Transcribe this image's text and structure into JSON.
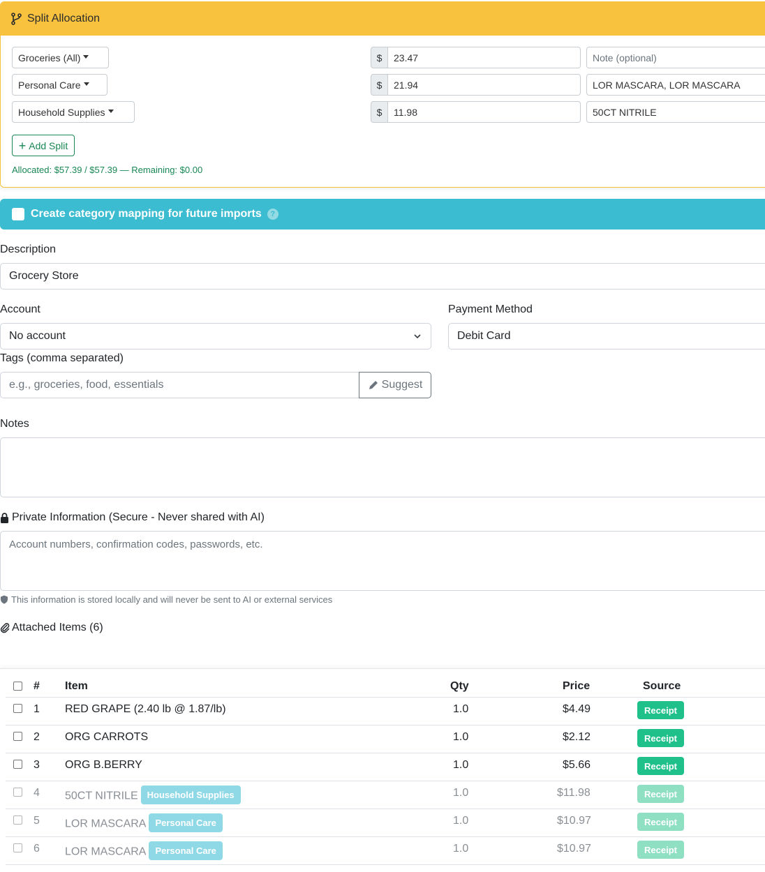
{
  "split": {
    "title": "Split Allocation",
    "rows": [
      {
        "category": "Groceries (All)",
        "currency": "$",
        "amount": "23.47",
        "note": "Note (optional)",
        "note_is_placeholder": true
      },
      {
        "category": "Personal Care",
        "currency": "$",
        "amount": "21.94",
        "note": "LOR MASCARA, LOR MASCARA",
        "note_is_placeholder": false
      },
      {
        "category": "Household Supplies",
        "currency": "$",
        "amount": "11.98",
        "note": "50CT NITRILE",
        "note_is_placeholder": false
      }
    ],
    "add_split_label": "Add Split",
    "allocated_text": "Allocated: $57.39 / $57.39 — Remaining: $0.00"
  },
  "mapping": {
    "label": "Create category mapping for future imports",
    "help": "?"
  },
  "form": {
    "description_label": "Description",
    "description_value": "Grocery Store",
    "account_label": "Account",
    "account_value": "No account",
    "payment_label": "Payment Method",
    "payment_value": "Debit Card",
    "tags_label": "Tags (comma separated)",
    "tags_placeholder": "e.g., groceries, food, essentials",
    "suggest_label": "Suggest",
    "notes_label": "Notes",
    "private_label": "Private Information (Secure - Never shared with AI)",
    "private_placeholder": "Account numbers, confirmation codes, passwords, etc.",
    "private_note": "This information is stored locally and will never be sent to AI or external services",
    "attached_label": "Attached Items (6)"
  },
  "table": {
    "headers": {
      "num": "#",
      "item": "Item",
      "qty": "Qty",
      "price": "Price",
      "source": "Source"
    },
    "rows": [
      {
        "num": "1",
        "item": "RED GRAPE (2.40 lb @ 1.87/lb)",
        "category": "",
        "qty": "1.0",
        "price": "$4.49",
        "source": "Receipt",
        "dim": false
      },
      {
        "num": "2",
        "item": "ORG CARROTS",
        "category": "",
        "qty": "1.0",
        "price": "$2.12",
        "source": "Receipt",
        "dim": false
      },
      {
        "num": "3",
        "item": "ORG B.BERRY",
        "category": "",
        "qty": "1.0",
        "price": "$5.66",
        "source": "Receipt",
        "dim": false
      },
      {
        "num": "4",
        "item": "50CT NITRILE",
        "category": "Household Supplies",
        "qty": "1.0",
        "price": "$11.98",
        "source": "Receipt",
        "dim": true
      },
      {
        "num": "5",
        "item": "LOR MASCARA",
        "category": "Personal Care",
        "qty": "1.0",
        "price": "$10.97",
        "source": "Receipt",
        "dim": true
      },
      {
        "num": "6",
        "item": "LOR MASCARA",
        "category": "Personal Care",
        "qty": "1.0",
        "price": "$10.97",
        "source": "Receipt",
        "dim": true
      }
    ]
  },
  "colors": {
    "split_header": "#f8c23f",
    "mapping_banner": "#3bbcd0",
    "success": "#198754",
    "receipt_badge": "#20c08a",
    "category_badge": "#8fd8e6"
  }
}
